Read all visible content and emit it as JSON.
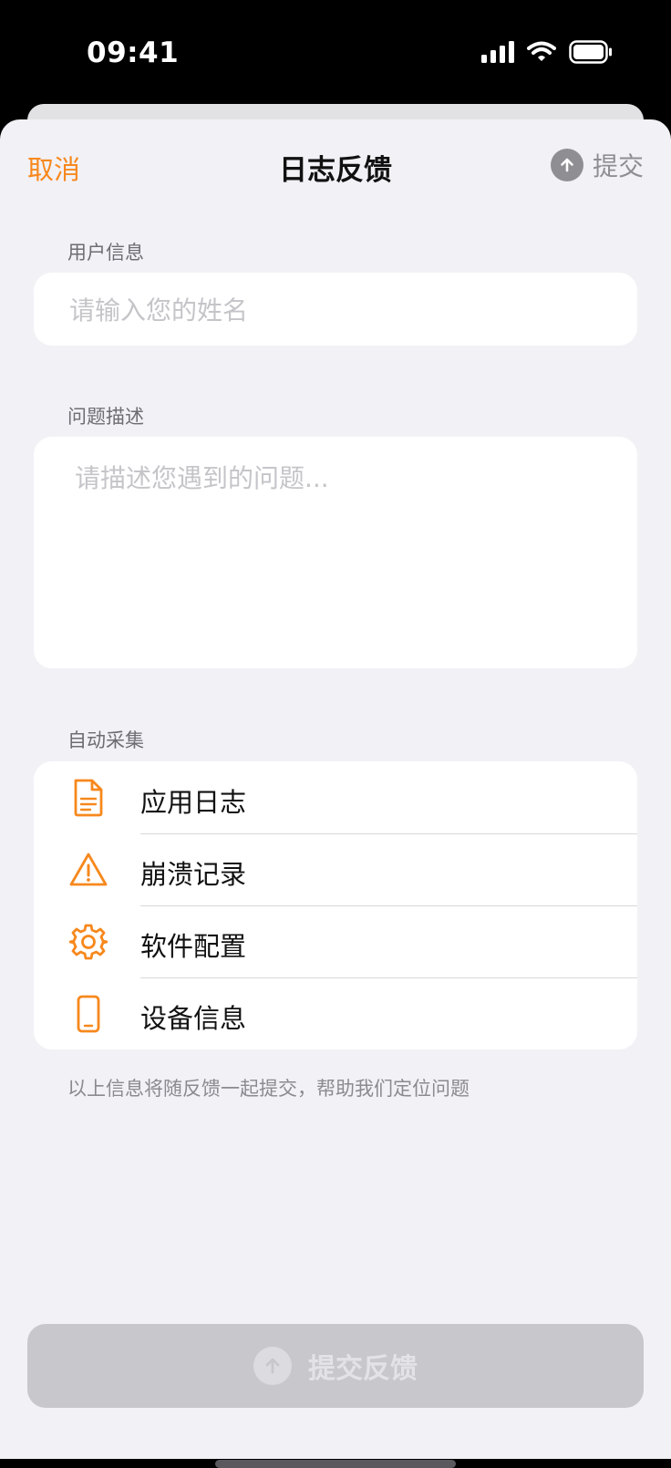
{
  "status_bar": {
    "time": "09:41"
  },
  "nav": {
    "cancel": "取消",
    "title": "日志反馈",
    "submit": "提交"
  },
  "user_info": {
    "label": "用户信息",
    "placeholder": "请输入您的姓名"
  },
  "problem": {
    "label": "问题描述",
    "placeholder": "请描述您遇到的问题..."
  },
  "auto_collect": {
    "label": "自动采集",
    "items": [
      {
        "label": "应用日志",
        "icon": "document-icon"
      },
      {
        "label": "崩溃记录",
        "icon": "warning-icon"
      },
      {
        "label": "软件配置",
        "icon": "gear-icon"
      },
      {
        "label": "设备信息",
        "icon": "phone-icon"
      }
    ],
    "footnote": "以上信息将随反馈一起提交，帮助我们定位问题"
  },
  "submit_button": {
    "label": "提交反馈"
  },
  "colors": {
    "accent": "#f7881d",
    "background": "#f2f1f6",
    "disabled": "#c7c7cc"
  }
}
